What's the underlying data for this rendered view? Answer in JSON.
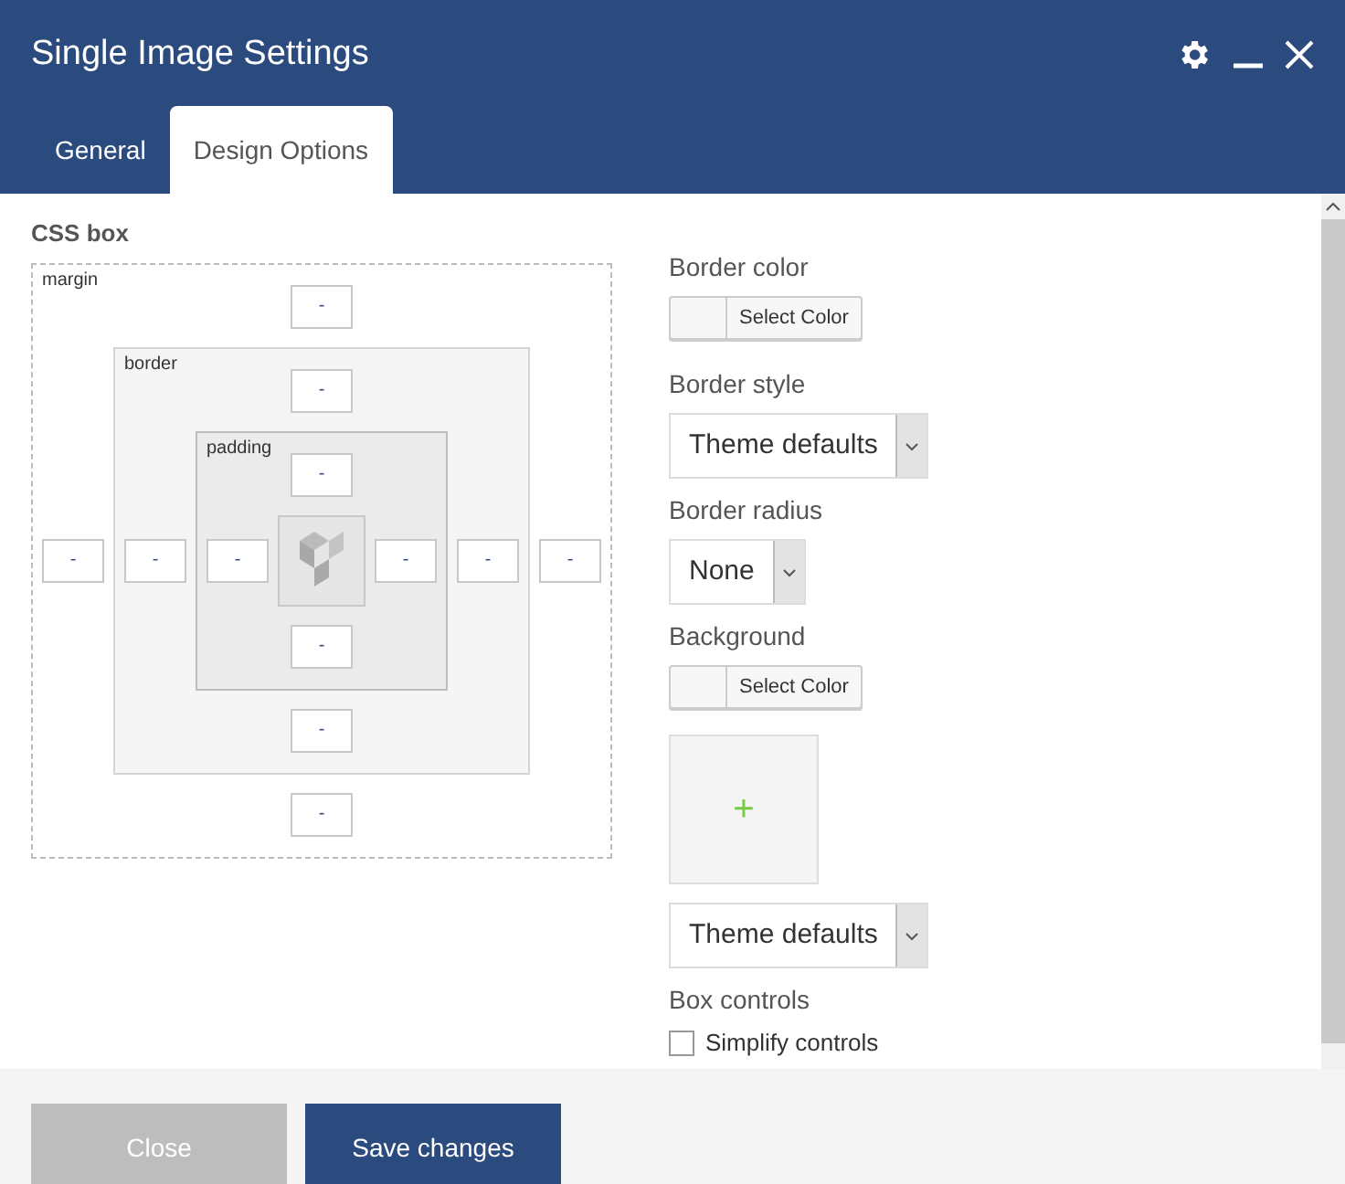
{
  "window": {
    "title": "Single Image Settings"
  },
  "tabs": [
    {
      "label": "General",
      "selected": false
    },
    {
      "label": "Design Options",
      "selected": true
    }
  ],
  "css_box": {
    "title": "CSS box",
    "layers": [
      {
        "label": "margin"
      },
      {
        "label": "border"
      },
      {
        "label": "padding"
      }
    ],
    "input_rows": [
      [
        "-"
      ],
      [
        "-"
      ],
      [
        "-"
      ],
      [
        "-",
        "-",
        "-",
        "-",
        "-",
        "-"
      ],
      [
        "-"
      ],
      [
        "-"
      ],
      [
        "-"
      ]
    ]
  },
  "fields": [
    {
      "kind": "color",
      "label": "Border color",
      "button": "Select Color"
    },
    {
      "kind": "select",
      "label": "Border style",
      "value": "Theme defaults"
    },
    {
      "kind": "select",
      "label": "Border radius",
      "value": "None"
    },
    {
      "kind": "color",
      "label": "Background",
      "button": "Select Color"
    },
    {
      "kind": "image",
      "icon": "+"
    },
    {
      "kind": "select",
      "value": "Theme defaults"
    },
    {
      "kind": "checkbox",
      "label": "Box controls",
      "option": "Simplify controls",
      "checked": false
    }
  ],
  "footer": {
    "buttons": [
      "Close",
      "Save changes"
    ]
  }
}
